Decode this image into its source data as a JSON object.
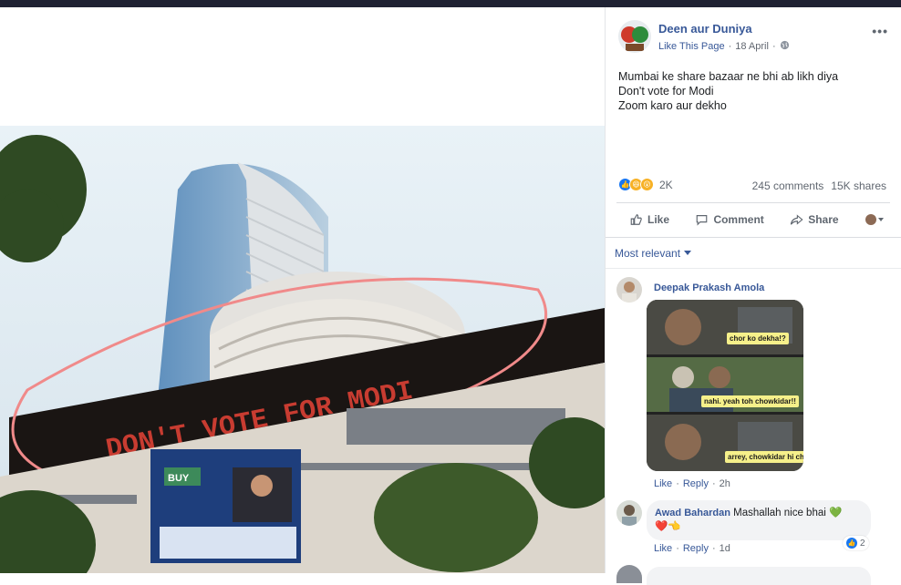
{
  "post": {
    "page_name": "Deen aur Duniya",
    "like_page": "Like This Page",
    "separator": "·",
    "date": "18 April",
    "privacy_icon": "globe-icon",
    "text_lines": [
      "Mumbai ke share bazaar ne bhi ab likh diya",
      "Don't vote for Modi",
      "Zoom karo aur dekho"
    ],
    "photo": {
      "ticker_text": "DON'T VOTE FOR MODI",
      "screen_text": "BUY"
    }
  },
  "stats": {
    "reaction_icons": [
      "like-icon",
      "haha-icon",
      "wow-icon"
    ],
    "reaction_count": "2K",
    "comments": "245 comments",
    "shares": "15K shares"
  },
  "actions": {
    "like": "Like",
    "comment": "Comment",
    "share": "Share"
  },
  "sort": {
    "label": "Most relevant"
  },
  "comments": [
    {
      "name": "Deepak Prakash Amola",
      "meme_captions": [
        "chor ko dekha!?",
        "nahi. yeah toh chowkidar!!",
        "arrey, chowkidar hi chor hai!!"
      ],
      "like": "Like",
      "reply": "Reply",
      "time": "2h"
    },
    {
      "name": "Awad Bahardan",
      "text": "Mashallah nice bhai",
      "emoji": "💚",
      "emoji2": "❤️👈",
      "like": "Like",
      "reply": "Reply",
      "time": "1d",
      "like_count": "2"
    }
  ],
  "colors": {
    "link": "#385898",
    "meta": "#606770",
    "like_blue": "#1877f2"
  }
}
